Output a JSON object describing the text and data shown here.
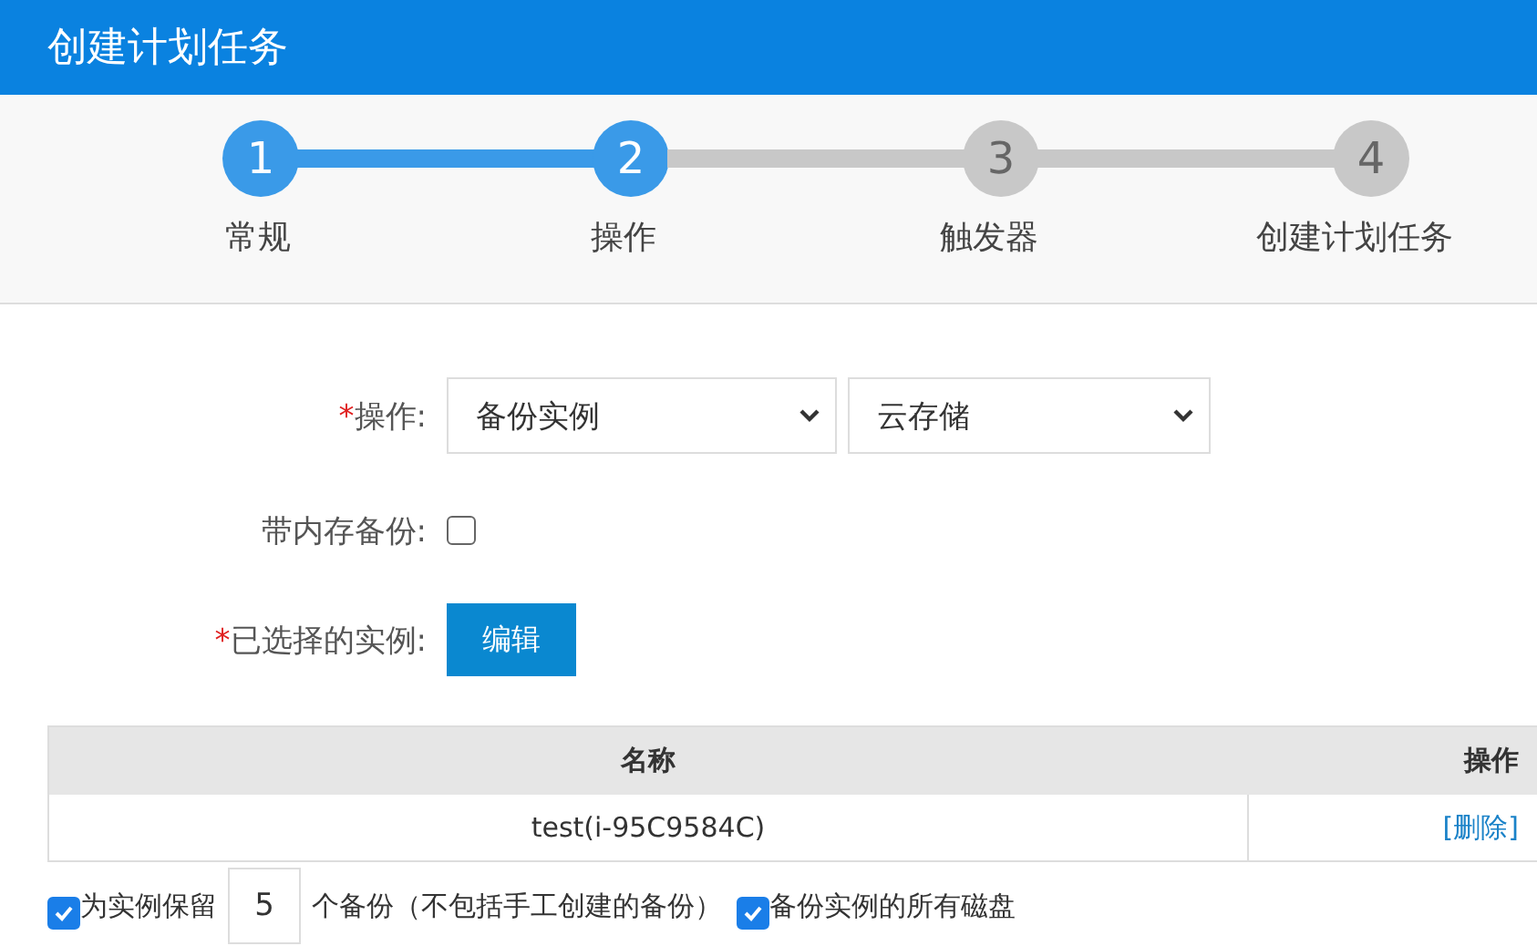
{
  "window": {
    "title": "创建计划任务"
  },
  "steps": [
    {
      "number": "1",
      "label": "常规",
      "reached": true
    },
    {
      "number": "2",
      "label": "操作",
      "reached": true
    },
    {
      "number": "3",
      "label": "触发器",
      "reached": false
    },
    {
      "number": "4",
      "label": "创建计划任务",
      "reached": false
    }
  ],
  "form": {
    "action": {
      "required_mark": "*",
      "label": "操作:",
      "type_value": "备份实例",
      "target_value": "云存储"
    },
    "memory_backup": {
      "label": "带内存备份:",
      "checked": false
    },
    "instances": {
      "required_mark": "*",
      "label": "已选择的实例:",
      "button": "编辑"
    }
  },
  "table": {
    "columns": [
      "名称",
      "操作"
    ],
    "rows": [
      {
        "name": "test(i-95C9584C)",
        "action": "[删除]"
      }
    ]
  },
  "retain": {
    "checked": true,
    "label_before": "为实例保留",
    "count": "5",
    "label_after": "个备份（不包括手工创建的备份）"
  },
  "all_disks": {
    "checked": true,
    "label": "备份实例的所有磁盘"
  }
}
